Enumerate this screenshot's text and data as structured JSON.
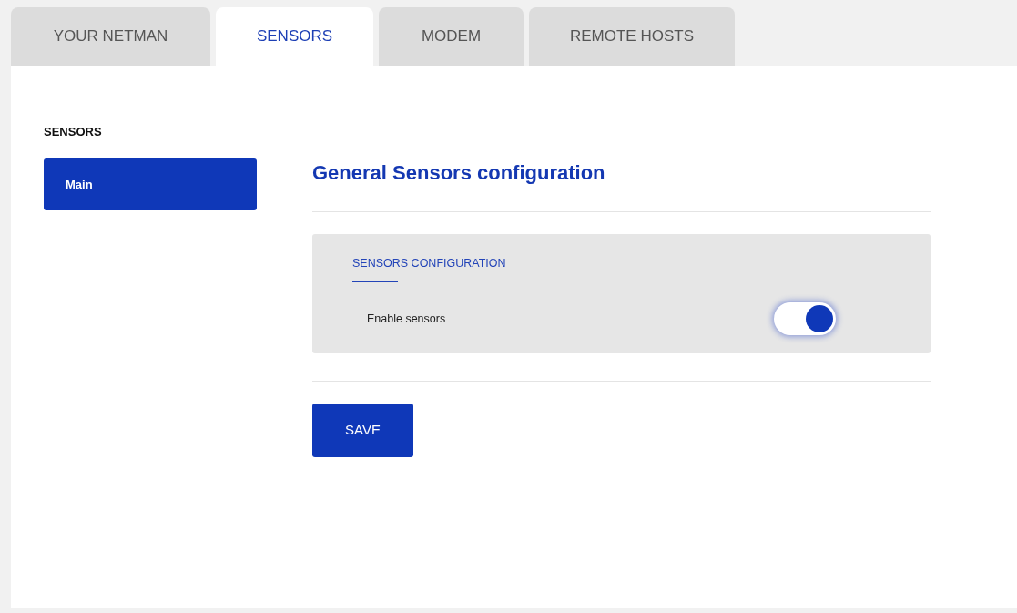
{
  "tabs": [
    {
      "label": "YOUR NETMAN",
      "selected": false
    },
    {
      "label": "SENSORS",
      "selected": true
    },
    {
      "label": "MODEM",
      "selected": false
    },
    {
      "label": "REMOTE HOSTS",
      "selected": false
    }
  ],
  "sidebar": {
    "title": "SENSORS",
    "items": [
      {
        "label": "Main",
        "selected": true
      }
    ]
  },
  "content": {
    "heading": "General Sensors configuration",
    "section": {
      "title": "SENSORS CONFIGURATION",
      "settings": [
        {
          "kind": "toggle",
          "label": "Enable sensors",
          "on": true
        }
      ]
    },
    "save_button": "SAVE"
  }
}
